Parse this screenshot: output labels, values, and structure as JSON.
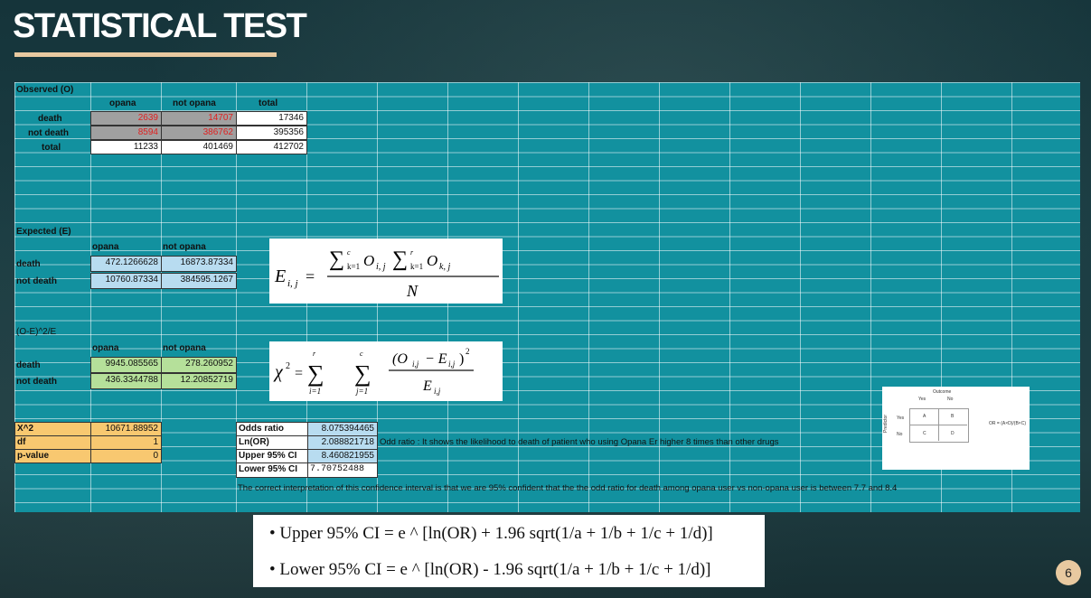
{
  "title": "STATISTICAL TEST",
  "observed": {
    "label": "Observed (O)",
    "cols": [
      "opana",
      "not opana",
      "total"
    ],
    "rows": [
      {
        "name": "death",
        "v": [
          "2639",
          "14707",
          "17346"
        ]
      },
      {
        "name": "not death",
        "v": [
          "8594",
          "386762",
          "395356"
        ]
      },
      {
        "name": "total",
        "v": [
          "11233",
          "401469",
          "412702"
        ]
      }
    ]
  },
  "expected": {
    "label": "Expected (E)",
    "cols": [
      "opana",
      "not opana"
    ],
    "rows": [
      {
        "name": "death",
        "v": [
          "472.1266628",
          "16873.87334"
        ]
      },
      {
        "name": "not death",
        "v": [
          "10760.87334",
          "384595.1267"
        ]
      }
    ]
  },
  "chi_terms": {
    "label": "(O-E)^2/E",
    "cols": [
      "opana",
      "not opana"
    ],
    "rows": [
      {
        "name": "death",
        "v": [
          "9945.085565",
          "278.260952"
        ]
      },
      {
        "name": "not death",
        "v": [
          "436.3344788",
          "12.20852719"
        ]
      }
    ]
  },
  "stats": [
    {
      "name": "X^2",
      "v": "10671.88952"
    },
    {
      "name": "df",
      "v": "1"
    },
    {
      "name": "p-value",
      "v": "0"
    }
  ],
  "odds": [
    {
      "name": "Odds ratio",
      "v": "8.075394465"
    },
    {
      "name": "Ln(OR)",
      "v": "2.088821718"
    },
    {
      "name": "Upper 95% CI",
      "v": "8.460821955"
    },
    {
      "name": "Lower 95% CI",
      "v": "7.70752488"
    }
  ],
  "odds_note": "Odd ratio : It shows the likelihood to death of patient who using Opana Er higher 8 times than other drugs",
  "ci_note": "The correct interpretation of this confidence interval is that we are 95% confident that the the odd ratio for death among opana user vs non-opana user is between 7.7 and 8.4",
  "ci_formulas": [
    "Upper 95% CI = e ^ [ln(OR) + 1.96 sqrt(1/a + 1/b + 1/c + 1/d)]",
    "Lower 95% CI = e ^ [ln(OR) - 1.96 sqrt(1/a + 1/b + 1/c + 1/d)]"
  ],
  "or_table": {
    "outcome": "Outcome",
    "yes": "Yes",
    "no": "No",
    "predictor": "Predictor",
    "a": "A",
    "b": "B",
    "c": "C",
    "d": "D",
    "formula": "OR = (A×D)/(B×C)"
  },
  "page_number": "6"
}
